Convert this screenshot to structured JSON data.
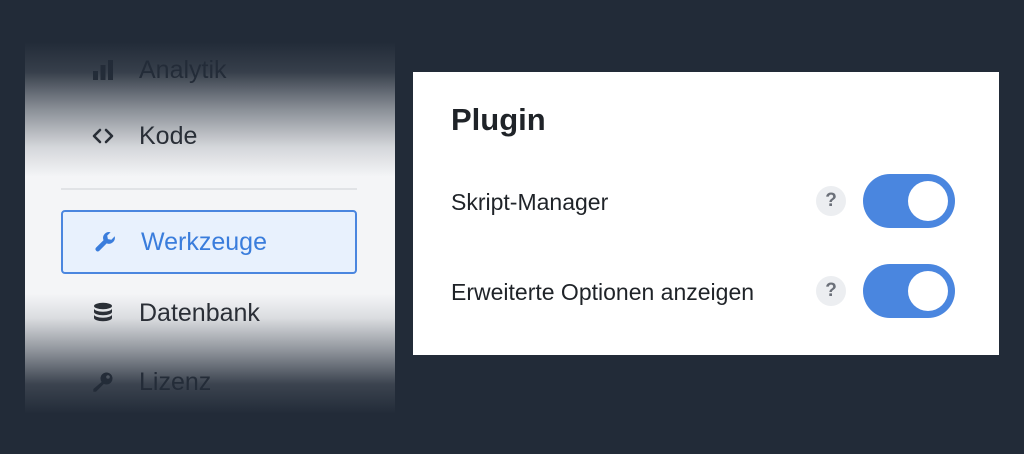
{
  "sidebar": {
    "items": [
      {
        "label": "Analytik",
        "icon": "bar-chart-icon"
      },
      {
        "label": "Kode",
        "icon": "code-icon"
      },
      {
        "label": "Werkzeuge",
        "icon": "wrench-icon",
        "active": true
      },
      {
        "label": "Datenbank",
        "icon": "database-icon"
      },
      {
        "label": "Lizenz",
        "icon": "key-icon"
      }
    ]
  },
  "panel": {
    "title": "Plugin",
    "settings": [
      {
        "label": "Skript-Manager",
        "help": "?",
        "enabled": true
      },
      {
        "label": "Erweiterte Optionen anzeigen",
        "help": "?",
        "enabled": true
      }
    ]
  },
  "colors": {
    "background": "#222b38",
    "accent": "#4a86df",
    "active_item_bg": "#e8f1fd",
    "panel_bg": "#ffffff"
  }
}
